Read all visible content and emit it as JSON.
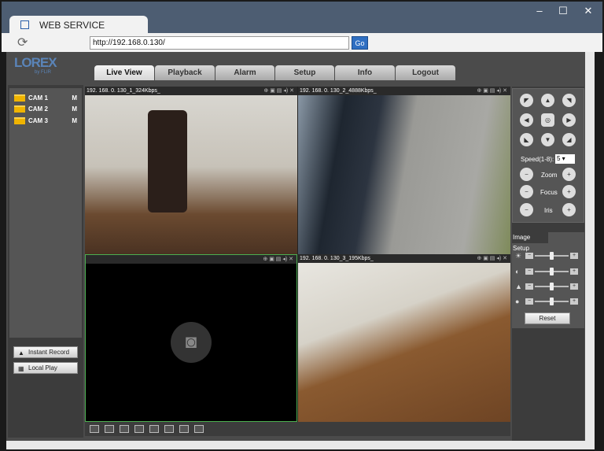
{
  "window": {
    "tab_title": "WEB SERVICE",
    "minimize": "–",
    "maximize": "☐",
    "close": "✕"
  },
  "address": {
    "url": "http://192.168.0.130/",
    "go_label": "Go"
  },
  "logo": {
    "brand": "LOREX",
    "sub": "by FLIR"
  },
  "nav": {
    "tabs": [
      "Live View",
      "Playback",
      "Alarm",
      "Setup",
      "Info",
      "Logout"
    ],
    "active": "Live View"
  },
  "cameras": [
    {
      "name": "CAM 1",
      "stream": "M"
    },
    {
      "name": "CAM 2",
      "stream": "M"
    },
    {
      "name": "CAM 3",
      "stream": "M"
    }
  ],
  "left_buttons": {
    "instant_record": "Instant Record",
    "local_play": "Local Play"
  },
  "feeds": [
    {
      "label": "192. 168. 0. 130_1_324Kbps_"
    },
    {
      "label": "192. 168. 0. 130_2_4888Kbps_"
    },
    {
      "label": ""
    },
    {
      "label": "192. 168. 0. 130_3_195Kbps_"
    }
  ],
  "ptz": {
    "speed_label": "Speed(1-8):",
    "speed_value": "5",
    "zoom": "Zoom",
    "focus": "Focus",
    "iris": "Iris"
  },
  "image_setup": {
    "title": "Image Setup",
    "reset": "Reset",
    "brightness": 0.5,
    "contrast": 0.5,
    "saturation": 0.5,
    "hue": 0.5
  }
}
